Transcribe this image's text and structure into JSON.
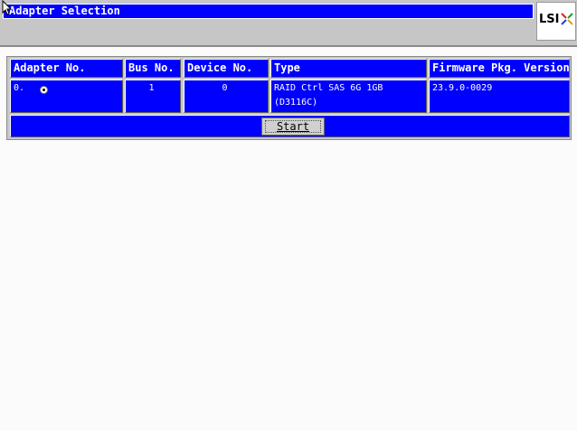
{
  "window": {
    "title": "Adapter Selection",
    "logo_text": "LSI",
    "logo_icon": "lsi-logo-icon"
  },
  "table": {
    "headers": [
      "Adapter No.",
      "Bus No.",
      "Device No.",
      "Type",
      "Firmware Pkg. Version"
    ],
    "rows": [
      {
        "adapter_no": "0.",
        "selected": true,
        "bus_no": "1",
        "device_no": "0",
        "type_line1": "RAID Ctrl SAS 6G 1GB",
        "type_line2": "(D3116C)",
        "firmware": "23.9.0-0029"
      }
    ]
  },
  "actions": {
    "start_label": "Start"
  },
  "colors": {
    "grid_blue": "#0000ff",
    "chrome_gray": "#c6c6c6",
    "background": "#fbfbfb"
  }
}
